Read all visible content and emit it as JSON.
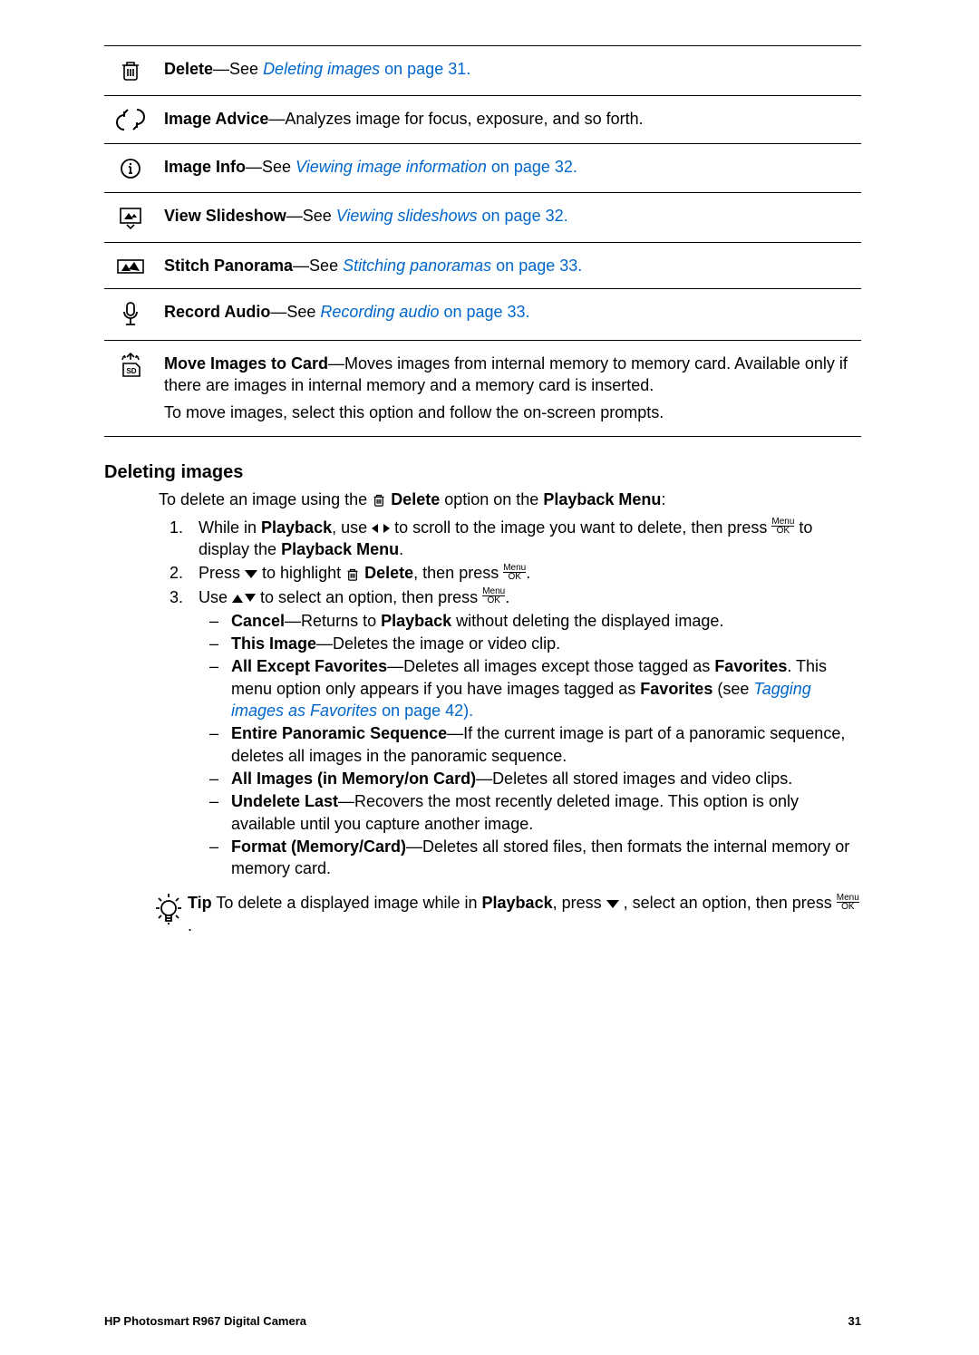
{
  "table": {
    "delete_b": "Delete",
    "delete_t": "—See ",
    "delete_l": "Deleting images",
    "delete_p": " on page 31.",
    "advice_b": "Image Advice",
    "advice_t": "—Analyzes image for focus, exposure, and so forth.",
    "info_b": "Image Info",
    "info_t": "—See ",
    "info_l": "Viewing image information",
    "info_p": " on page 32.",
    "slide_b": "View Slideshow",
    "slide_t": "—See ",
    "slide_l": "Viewing slideshows",
    "slide_p": " on page 32.",
    "stitch_b": "Stitch Panorama",
    "stitch_t": "—See ",
    "stitch_l": "Stitching panoramas",
    "stitch_p": " on page 33.",
    "rec_b": "Record Audio",
    "rec_t": "—See ",
    "rec_l": "Recording audio",
    "rec_p": " on page 33.",
    "move_b": "Move Images to Card",
    "move_t": "—Moves images from internal memory to memory card. Available only if there are images in internal memory and a memory card is inserted.",
    "move_t2": "To move images, select this option and follow the on-screen prompts."
  },
  "heading": "Deleting images",
  "intro1": "To delete an image using the ",
  "intro2": " Delete",
  "intro3": " option on the ",
  "intro4": "Playback Menu",
  "intro5": ":",
  "step1a": "While in ",
  "step1b": "Playback",
  "step1c": ", use ",
  "step1d": " to scroll to the image you want to delete, then press ",
  "step1e": " to display the ",
  "step1f": "Playback Menu",
  "step1g": ".",
  "step2a": "Press ",
  "step2b": " to highlight ",
  "step2c": " Delete",
  "step2d": ", then press ",
  "step2e": ".",
  "step3a": "Use ",
  "step3b": " to select an option, then press ",
  "step3c": ".",
  "b_cancel_b": "Cancel",
  "b_cancel_t": "—Returns to ",
  "b_cancel_b2": "Playback",
  "b_cancel_t2": " without deleting the displayed image.",
  "b_this_b": "This Image",
  "b_this_t": "—Deletes the image or video clip.",
  "b_aef_b": "All Except Favorites",
  "b_aef_t": "—Deletes all images except those tagged as ",
  "b_aef_b2": "Favorites",
  "b_aef_t2": ". This menu option only appears if you have images tagged as ",
  "b_aef_b3": "Favorites",
  "b_aef_t3": " (see ",
  "b_aef_l": "Tagging images as Favorites",
  "b_aef_p": " on page 42).",
  "b_eps_b": "Entire Panoramic Sequence",
  "b_eps_t": "—If the current image is part of a panoramic sequence, deletes all images in the panoramic sequence.",
  "b_ai_b": "All Images (in Memory/on Card)",
  "b_ai_t": "—Deletes all stored images and video clips.",
  "b_ul_b": "Undelete Last",
  "b_ul_t": "—Recovers the most recently deleted image. This option is only available until you capture another image.",
  "b_fm_b": "Format (Memory/Card)",
  "b_fm_t": "—Deletes all stored files, then formats the internal memory or memory card.",
  "tip_b": "Tip",
  "tip_t1": "   To delete a displayed image while in ",
  "tip_b2": "Playback",
  "tip_t2": ", press ",
  "tip_t3": " , select an option, then press ",
  "tip_t4": ".",
  "footer_left": "HP Photosmart R967 Digital Camera",
  "footer_right": "31"
}
